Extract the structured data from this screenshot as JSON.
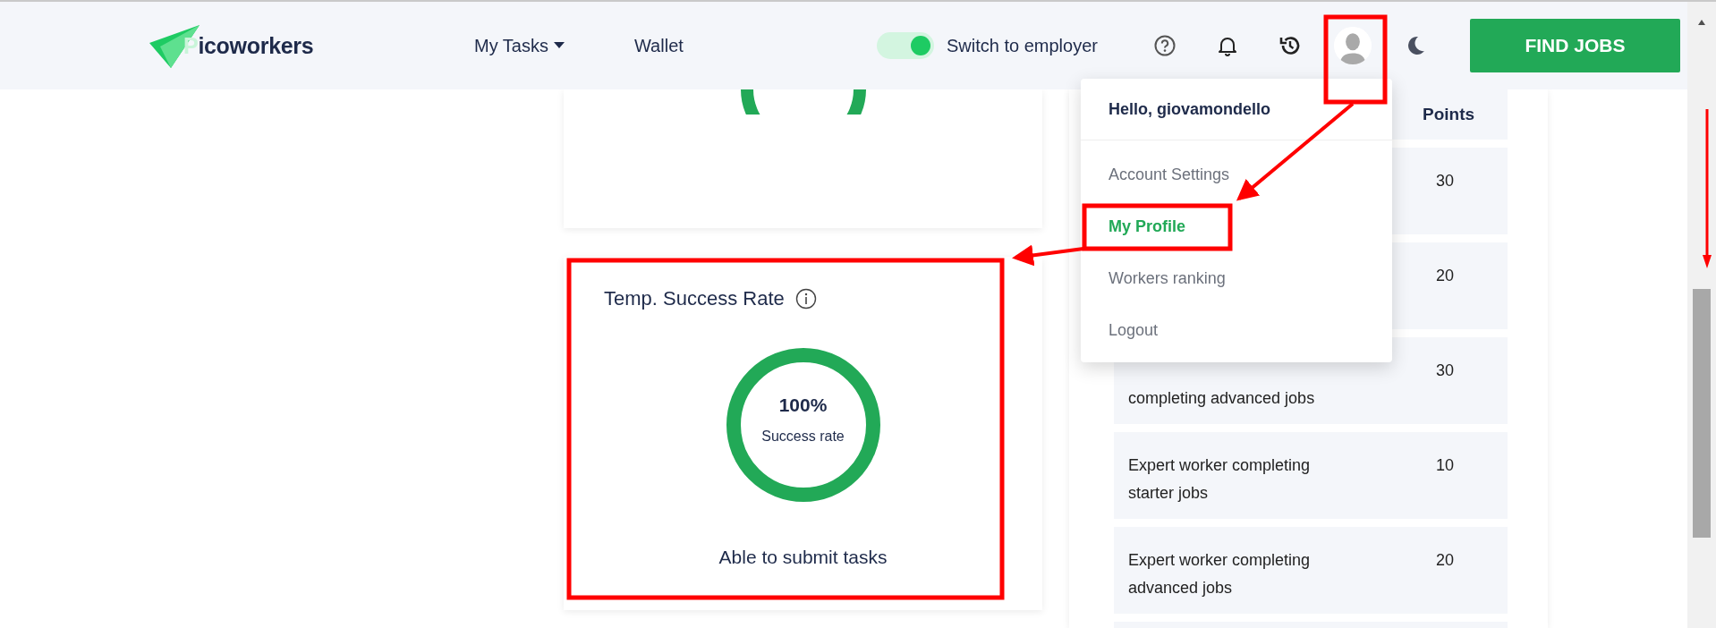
{
  "header": {
    "logo": "Picoworkers",
    "nav": [
      {
        "label": "My Tasks",
        "dropdown": true
      },
      {
        "label": "Wallet",
        "dropdown": false
      }
    ],
    "toggle": {
      "label": "Switch to employer",
      "on": true
    },
    "cta": "FIND JOBS"
  },
  "menu": {
    "greeting": "Hello, giovamondello",
    "items": [
      {
        "label": "Account Settings",
        "selected": false
      },
      {
        "label": "My Profile",
        "selected": true
      },
      {
        "label": "Workers ranking",
        "selected": false
      },
      {
        "label": "Logout",
        "selected": false
      }
    ]
  },
  "success_card": {
    "title": "Temp. Success Rate",
    "value": "100%",
    "caption": "Success rate",
    "level": 1,
    "status": "Able to submit tasks"
  },
  "table": {
    "columns": [
      "Points"
    ],
    "rows": [
      {
        "points": "30"
      },
      {
        "points": "20"
      },
      {
        "label": "completing advanced jobs",
        "points": "30"
      },
      {
        "label": "Expert worker completing starter jobs",
        "points": "10"
      },
      {
        "label": "Expert worker completing advanced jobs",
        "points": "20"
      }
    ]
  }
}
